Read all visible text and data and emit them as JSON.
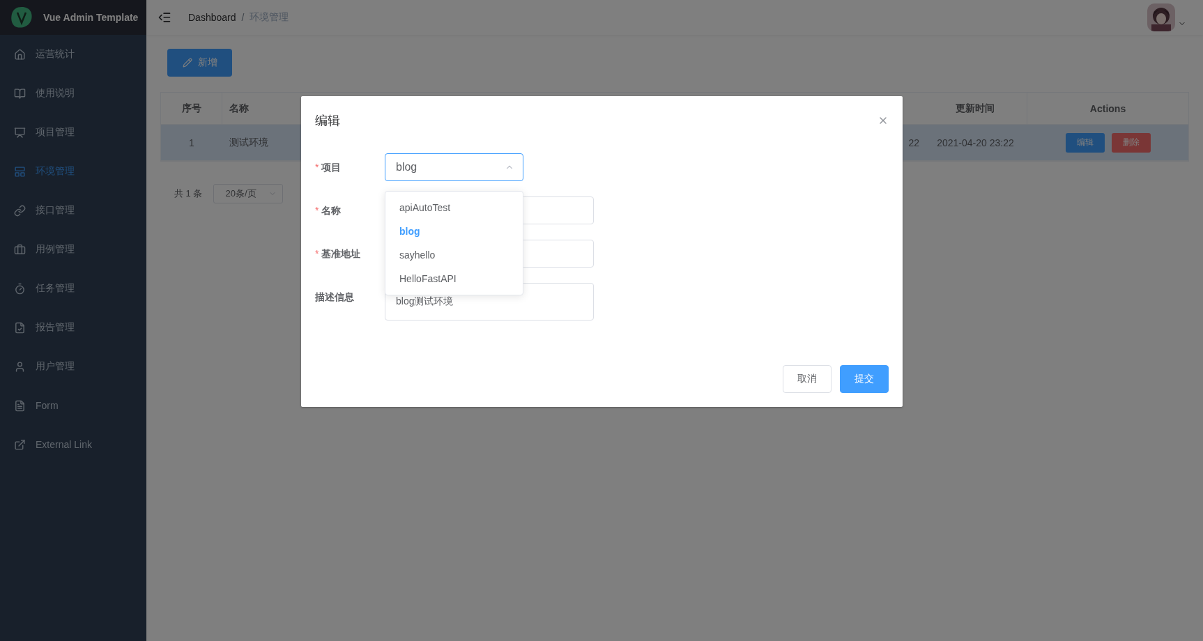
{
  "sidebar": {
    "logo_text": "Vue Admin Template",
    "items": [
      {
        "label": "运营统计",
        "selected": false
      },
      {
        "label": "使用说明",
        "selected": false
      },
      {
        "label": "项目管理",
        "selected": false
      },
      {
        "label": "环境管理",
        "selected": true
      },
      {
        "label": "接口管理",
        "selected": false
      },
      {
        "label": "用例管理",
        "selected": false
      },
      {
        "label": "任务管理",
        "selected": false
      },
      {
        "label": "报告管理",
        "selected": false
      },
      {
        "label": "用户管理",
        "selected": false
      },
      {
        "label": "Form",
        "selected": false
      },
      {
        "label": "External Link",
        "selected": false
      }
    ]
  },
  "navbar": {
    "breadcrumb": [
      "Dashboard",
      "环境管理"
    ],
    "separator": "/"
  },
  "toolbar": {
    "add_button": "新增"
  },
  "table": {
    "columns": [
      {
        "label": "序号"
      },
      {
        "label": "名称"
      },
      {
        "label": "更新时间"
      },
      {
        "label": "Actions"
      }
    ],
    "rows": [
      {
        "index": "1",
        "name": "测试环境",
        "column_5": "22",
        "updated": "2021-04-20 23:22",
        "selected": true,
        "actions": [
          {
            "label": "编辑",
            "kind": "primary"
          },
          {
            "label": "删除",
            "kind": "danger"
          }
        ]
      }
    ]
  },
  "pagination": {
    "total": "共 1 条",
    "page_size": "20条/页"
  },
  "dialog": {
    "title": "编辑",
    "required_mark": "*",
    "fields": [
      {
        "kind": "select",
        "label": "项目",
        "required": true,
        "value": "blog",
        "expanded": true
      },
      {
        "kind": "input",
        "label": "名称",
        "required": true
      },
      {
        "kind": "input",
        "label": "基准地址",
        "required": true
      },
      {
        "kind": "textarea",
        "label": "描述信息",
        "required": false,
        "value": "blog测试环境"
      }
    ],
    "options": [
      {
        "label": "apiAutoTest",
        "selected": false
      },
      {
        "label": "blog",
        "selected": true
      },
      {
        "label": "sayhello",
        "selected": false
      },
      {
        "label": "HelloFastAPI",
        "selected": false
      }
    ],
    "buttons": [
      {
        "label": "取消",
        "kind": "default"
      },
      {
        "label": "提交",
        "kind": "primary"
      }
    ]
  }
}
